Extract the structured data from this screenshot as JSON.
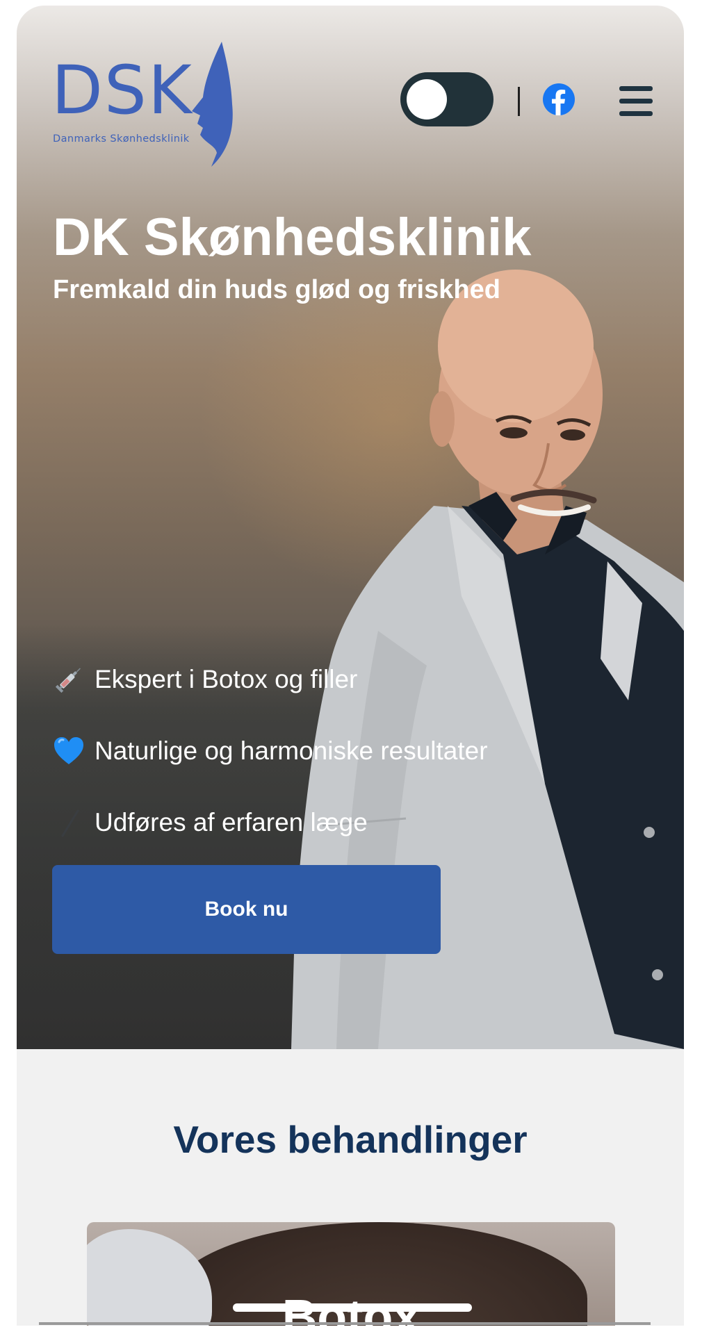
{
  "header": {
    "logo_text": "DSK",
    "logo_subtitle": "Danmarks Skønhedsklinik",
    "theme_toggle": "dark-mode-toggle",
    "social_icon": "facebook-icon",
    "menu_icon": "hamburger-menu-icon"
  },
  "hero": {
    "title": "DK Skønhedsklinik",
    "subtitle": "Fremkald din huds glød og friskhed",
    "features": [
      {
        "icon": "syringe-icon",
        "text": "Ekspert i Botox og filler"
      },
      {
        "icon": "blue-heart-icon",
        "text": "Naturlige og harmoniske resultater"
      },
      {
        "icon": "check-icon",
        "text": "Udføres af erfaren læge"
      }
    ],
    "cta_label": "Book nu"
  },
  "treatments": {
    "heading": "Vores behandlinger",
    "cards": [
      {
        "title": "Botox"
      }
    ]
  },
  "colors": {
    "brand_blue": "#3f62b9",
    "button_blue": "#2e5aa6",
    "heading_navy": "#14335a",
    "toggle_dark": "#213239",
    "facebook_blue": "#1877f2",
    "section_bg": "#f1f1f1"
  }
}
